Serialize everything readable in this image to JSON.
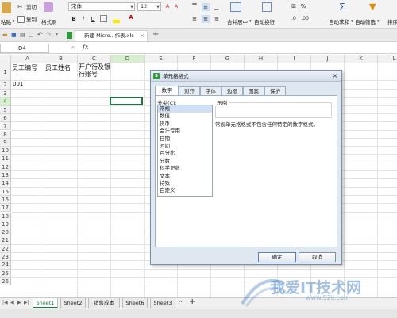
{
  "ribbon": {
    "paste": "粘贴",
    "cut": "剪切",
    "copy": "复制",
    "format_painter": "格式刷",
    "font_name": "宋体",
    "font_size": "12",
    "bold": "B",
    "italic": "I",
    "underline": "U",
    "merge_center": "合并居中",
    "wrap_text": "自动换行",
    "percent": "%",
    "auto_sum": "自动求和",
    "auto_filter": "自动筛选",
    "sort": "排序"
  },
  "tabbar": {
    "doc_tab": "新建 Micro...作表.xls",
    "close": "×",
    "add": "+"
  },
  "formula_bar": {
    "name_box": "D4",
    "fx": "fx"
  },
  "grid": {
    "columns": [
      "A",
      "B",
      "C",
      "D",
      "E",
      "F",
      "G",
      "H",
      "I",
      "J",
      "K",
      "L"
    ],
    "selected_column": "D",
    "rows": [
      "1",
      "2",
      "3",
      "4",
      "5",
      "6",
      "7",
      "8",
      "9",
      "10",
      "11",
      "12",
      "13",
      "14",
      "15",
      "16",
      "17",
      "18",
      "19",
      "20",
      "21",
      "22",
      "23",
      "24",
      "25",
      "26"
    ],
    "selected_row": "4",
    "cells": {
      "A1": "员工编号",
      "B1": "员工姓名",
      "C1": "开户行及银行账号",
      "A2": "001"
    }
  },
  "sheets": {
    "tabs": [
      "Sheet1",
      "Sheet2",
      "销售成本",
      "Sheet6",
      "Sheet3"
    ],
    "active": "Sheet1",
    "more": "···",
    "add": "+"
  },
  "dialog": {
    "title": "单元格格式",
    "tabs": [
      "数字",
      "对齐",
      "字体",
      "边框",
      "图案",
      "保护"
    ],
    "active_tab": "数字",
    "category_label": "分类(C):",
    "categories": [
      "常规",
      "数值",
      "货币",
      "会计专用",
      "日期",
      "时间",
      "百分比",
      "分数",
      "科学记数",
      "文本",
      "特殊",
      "自定义"
    ],
    "selected_category": "常规",
    "sample_label": "示例",
    "description": "常规单元格格式不包含任何特定的数字格式。",
    "ok": "确定",
    "cancel": "取消",
    "close": "×"
  },
  "watermark": {
    "main": "我爱IT技术网",
    "url": "www.52ij.com"
  },
  "colors": {
    "accent": "#217346",
    "dialog_bg": "#dfe7f1",
    "selected_header": "#d9edd0"
  }
}
